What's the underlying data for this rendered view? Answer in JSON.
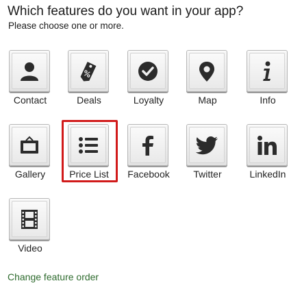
{
  "header": {
    "title": "Which features do you want in your app?",
    "subtitle": "Please choose one or more."
  },
  "features": [
    {
      "label": "Contact",
      "icon": "person-icon",
      "selected": false
    },
    {
      "label": "Deals",
      "icon": "price-tag-icon",
      "selected": false
    },
    {
      "label": "Loyalty",
      "icon": "checkmark-circle-icon",
      "selected": false
    },
    {
      "label": "Map",
      "icon": "map-pin-icon",
      "selected": false
    },
    {
      "label": "Info",
      "icon": "info-icon",
      "selected": false
    },
    {
      "label": "Gallery",
      "icon": "picture-frame-icon",
      "selected": false
    },
    {
      "label": "Price List",
      "icon": "list-icon",
      "selected": true
    },
    {
      "label": "Facebook",
      "icon": "facebook-icon",
      "selected": false
    },
    {
      "label": "Twitter",
      "icon": "twitter-bird-icon",
      "selected": false
    },
    {
      "label": "LinkedIn",
      "icon": "linkedin-icon",
      "selected": false
    },
    {
      "label": "Video",
      "icon": "film-strip-icon",
      "selected": false
    }
  ],
  "footer": {
    "change_order_label": "Change feature order"
  },
  "colors": {
    "selection_border": "#d11a1a",
    "icon": "#2b2b2b",
    "link": "#2e6b2e"
  }
}
